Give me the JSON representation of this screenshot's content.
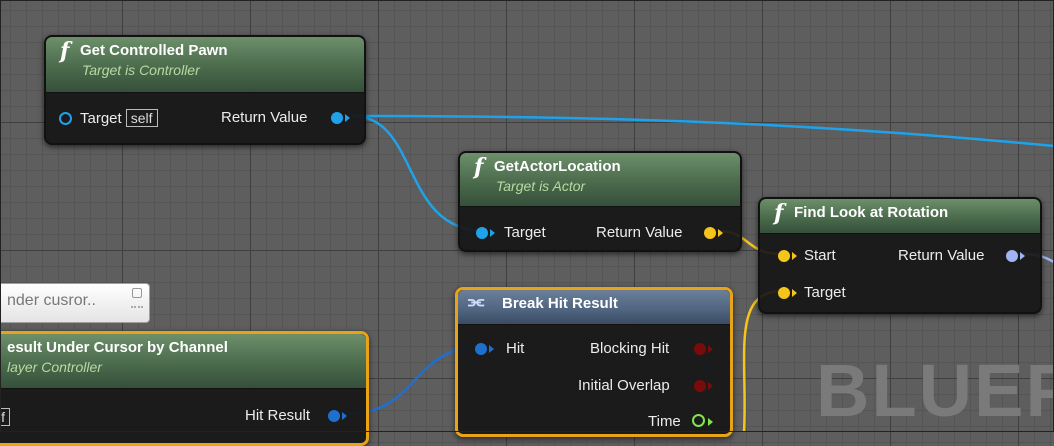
{
  "nodes": {
    "get_controlled_pawn": {
      "title": "Get Controlled Pawn",
      "subtitle": "Target is Controller",
      "input_label": "Target",
      "input_value": "self",
      "output_label": "Return Value"
    },
    "get_actor_location": {
      "title": "GetActorLocation",
      "subtitle": "Target is Actor",
      "input_label": "Target",
      "output_label": "Return Value"
    },
    "find_look_at_rotation": {
      "title": "Find Look at Rotation",
      "input_start": "Start",
      "input_target": "Target",
      "output_label": "Return Value"
    },
    "break_hit_result": {
      "title": "Break Hit Result",
      "input_label": "Hit",
      "outputs": [
        "Blocking Hit",
        "Initial Overlap",
        "Time"
      ]
    },
    "hit_result_under_cursor": {
      "title": "esult Under Cursor by Channel",
      "subtitle": "layer Controller",
      "input_value": "lf",
      "output_label": "Hit Result"
    }
  },
  "comment": {
    "text": "nder cusror.."
  },
  "watermark": "BLUEP",
  "colors": {
    "exec_white": "#ffffff",
    "object_pin": "#1fa2ea",
    "vector_pin": "#f5c51b",
    "rotator_pin": "#9fb3f5",
    "struct_pin": "#1f6fcf",
    "bool_pin": "#7a0b0b",
    "float_pin": "#82e34e",
    "selection": "#e8a317"
  }
}
